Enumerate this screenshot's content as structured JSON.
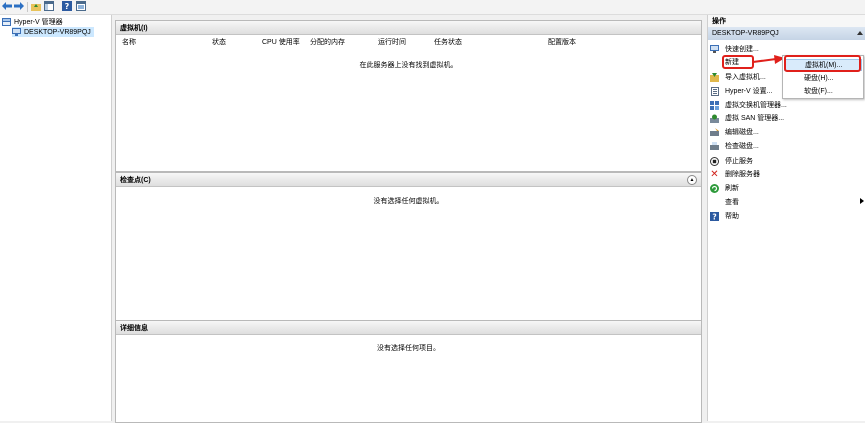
{
  "toolbar": {
    "buttons": [
      "back-icon",
      "forward-icon",
      "up-folder-icon",
      "show-hide-tree-icon",
      "help-icon",
      "console-icon"
    ]
  },
  "tree": {
    "root_label": "Hyper-V 管理器",
    "server_label": "DESKTOP-VR89PQJ"
  },
  "vm_pane": {
    "title": "虚拟机(I)",
    "columns": [
      "名称",
      "状态",
      "CPU 使用率",
      "分配的内存",
      "运行时间",
      "任务状态",
      "配置版本"
    ],
    "empty_text": "在此服务器上没有找到虚拟机。"
  },
  "checkpoint_pane": {
    "title": "检查点(C)",
    "empty_text": "没有选择任何虚拟机。"
  },
  "details_pane": {
    "title": "详细信息",
    "empty_text": "没有选择任何项目。"
  },
  "actions": {
    "title": "操作",
    "server": "DESKTOP-VR89PQJ",
    "items": [
      {
        "label": "快速创建...",
        "icon": "quick-create-icon"
      },
      {
        "label": "新建",
        "icon": "none"
      },
      {
        "label": "导入虚拟机...",
        "icon": "import-icon"
      },
      {
        "label": "Hyper-V 设置...",
        "icon": "settings-icon"
      },
      {
        "label": "虚拟交换机管理器...",
        "icon": "switch-icon"
      },
      {
        "label": "虚拟 SAN 管理器...",
        "icon": "san-icon"
      },
      {
        "label": "编辑磁盘...",
        "icon": "edit-disk-icon"
      },
      {
        "label": "检查磁盘...",
        "icon": "inspect-disk-icon"
      },
      {
        "label": "停止服务",
        "icon": "stop-icon"
      },
      {
        "label": "删除服务器",
        "icon": "delete-icon"
      },
      {
        "label": "刷新",
        "icon": "refresh-icon"
      },
      {
        "label": "查看",
        "icon": "none"
      },
      {
        "label": "帮助",
        "icon": "help-icon"
      }
    ]
  },
  "new_menu": {
    "items": [
      "虚拟机(M)...",
      "硬盘(H)...",
      "软盘(F)..."
    ]
  },
  "colors": {
    "highlight": "#e0201b",
    "selection": "#cce8ff",
    "header_band": "#c5d4e6"
  }
}
